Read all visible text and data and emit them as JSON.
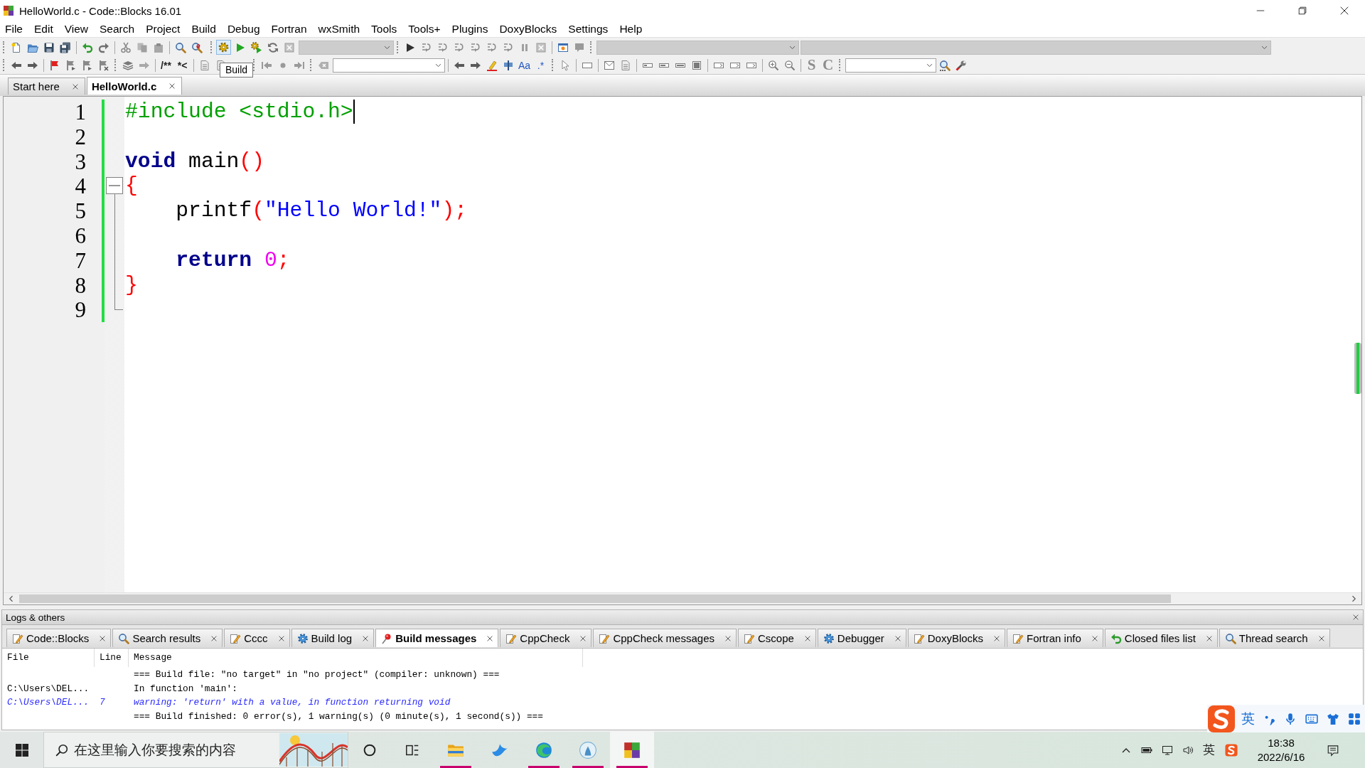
{
  "window": {
    "title": "HelloWorld.c - Code::Blocks 16.01"
  },
  "menu": [
    "File",
    "Edit",
    "View",
    "Search",
    "Project",
    "Build",
    "Debug",
    "Fortran",
    "wxSmith",
    "Tools",
    "Tools+",
    "Plugins",
    "DoxyBlocks",
    "Settings",
    "Help"
  ],
  "toolbar": {
    "text_buttons": [
      {
        "label": "/**",
        "kind": "comment"
      },
      {
        "label": "*<",
        "kind": "comment"
      },
      {
        "label": "Aa",
        "kind": "match"
      },
      {
        "label": ".*",
        "kind": "match"
      },
      {
        "label": "S",
        "kind": "letter"
      },
      {
        "label": "C",
        "kind": "letter"
      }
    ],
    "build_button": {
      "hovered": true,
      "tooltip": "Build"
    }
  },
  "editor_tabs": [
    {
      "label": "Start here",
      "selected": false
    },
    {
      "label": "HelloWorld.c",
      "selected": true
    }
  ],
  "editor": {
    "lines": [
      {
        "number": "1",
        "changed": true,
        "cursor": true,
        "tokens": [
          {
            "text": "#include <stdio.h>",
            "kind": "preprocessor"
          }
        ]
      },
      {
        "number": "2",
        "changed": true,
        "cursor": false
      },
      {
        "number": "3",
        "changed": true,
        "cursor": false,
        "tokens": [
          {
            "text": "void",
            "kind": "keyword"
          },
          {
            "text": " main",
            "kind": "identifier"
          },
          {
            "text": "()",
            "kind": "operator"
          }
        ]
      },
      {
        "number": "4",
        "changed": true,
        "cursor": false,
        "fold": {
          "kind": "start",
          "expanded": true
        },
        "tokens": [
          {
            "text": "{",
            "kind": "operator"
          }
        ]
      },
      {
        "number": "5",
        "changed": true,
        "cursor": false,
        "fold": {
          "kind": "line"
        },
        "tokens": [
          {
            "text": "    printf",
            "kind": "identifier"
          },
          {
            "text": "(",
            "kind": "operator"
          },
          {
            "text": "\"Hello World!\"",
            "kind": "string"
          },
          {
            "text": ");",
            "kind": "operator"
          }
        ]
      },
      {
        "number": "6",
        "changed": true,
        "cursor": false,
        "fold": {
          "kind": "line"
        }
      },
      {
        "number": "7",
        "changed": true,
        "cursor": false,
        "fold": {
          "kind": "line"
        },
        "tokens": [
          {
            "text": "    return",
            "kind": "keyword"
          },
          {
            "text": " 0",
            "kind": "number"
          },
          {
            "text": ";",
            "kind": "operator"
          }
        ]
      },
      {
        "number": "8",
        "changed": true,
        "cursor": false,
        "fold": {
          "kind": "line"
        },
        "tokens": [
          {
            "text": "}",
            "kind": "operator"
          }
        ]
      },
      {
        "number": "9",
        "changed": true,
        "cursor": false,
        "fold": {
          "kind": "end"
        }
      }
    ]
  },
  "logs": {
    "title": "Logs & others",
    "tabs": [
      {
        "label": "Code::Blocks",
        "kind": "log",
        "selected": false
      },
      {
        "label": "Search results",
        "kind": "search",
        "selected": false
      },
      {
        "label": "Cccc",
        "kind": "log",
        "selected": false
      },
      {
        "label": "Build log",
        "kind": "process",
        "selected": false
      },
      {
        "label": "Build messages",
        "kind": "messages",
        "selected": true
      },
      {
        "label": "CppCheck",
        "kind": "log",
        "selected": false
      },
      {
        "label": "CppCheck messages",
        "kind": "log",
        "selected": false
      },
      {
        "label": "Cscope",
        "kind": "log",
        "selected": false
      },
      {
        "label": "Debugger",
        "kind": "process",
        "selected": false
      },
      {
        "label": "DoxyBlocks",
        "kind": "log",
        "selected": false
      },
      {
        "label": "Fortran info",
        "kind": "log",
        "selected": false
      },
      {
        "label": "Closed files list",
        "kind": "history",
        "selected": false
      },
      {
        "label": "Thread search",
        "kind": "search",
        "selected": false
      }
    ],
    "columns": [
      "File",
      "Line",
      "Message"
    ],
    "rows": [
      {
        "kind": "info",
        "message": "=== Build file: \"no target\" in \"no project\" (compiler: unknown) ==="
      },
      {
        "kind": "info",
        "file": "C:\\Users\\DEL...",
        "message": "In function 'main':"
      },
      {
        "kind": "warning",
        "file": "C:\\Users\\DEL...",
        "line": "7",
        "message": "warning: 'return' with a value, in function returning void"
      },
      {
        "kind": "info",
        "message": "=== Build finished: 0 error(s), 1 warning(s) (0 minute(s), 1 second(s)) ==="
      }
    ]
  },
  "ime_bar": {
    "mode": "英"
  },
  "taskbar": {
    "search_placeholder": "在这里输入你要搜索的内容",
    "apps": [
      {
        "kind": "explorer",
        "running": true,
        "active": false
      },
      {
        "kind": "messenger",
        "running": false,
        "active": false
      },
      {
        "kind": "browser",
        "running": true,
        "active": false
      },
      {
        "kind": "client",
        "running": true,
        "active": false
      },
      {
        "kind": "ide",
        "running": true,
        "active": true
      }
    ],
    "tray": {
      "ime_mode": "英",
      "time": "18:38",
      "date": "2022/6/16"
    }
  }
}
